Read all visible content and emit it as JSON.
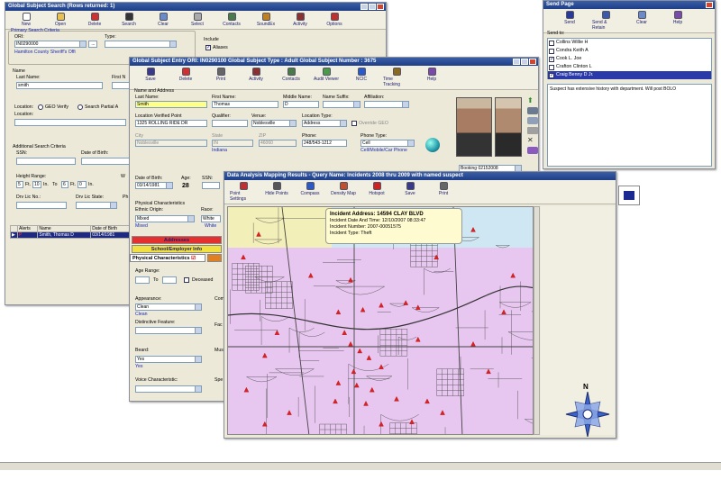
{
  "colors": {
    "titlebar": "#1e3e86",
    "map_bg": "#e7c6f0",
    "map_alt": "#cfe7f2",
    "map_yellow": "#f3efb8",
    "incident": "#e02020",
    "highlight": "#ffff88",
    "red_tab": "#e53030",
    "yellow_tab": "#f0e040"
  },
  "search": {
    "title": "Global Subject Search (Rows returned: 1)",
    "toolbar": [
      {
        "label": "New",
        "icon": "new-icon"
      },
      {
        "label": "Open",
        "icon": "folder-icon"
      },
      {
        "label": "Delete",
        "icon": "delete-icon"
      },
      {
        "label": "Search",
        "icon": "binoculars-icon"
      },
      {
        "label": "Clear",
        "icon": "clear-icon"
      },
      {
        "label": "Select",
        "icon": "select-icon"
      },
      {
        "label": "Contacts",
        "icon": "contacts-icon"
      },
      {
        "label": "SoundEx",
        "icon": "soundex-icon"
      },
      {
        "label": "Activity",
        "icon": "activity-icon"
      },
      {
        "label": "Options",
        "icon": "options-icon"
      }
    ],
    "primary_group": "Primary Search Criteria",
    "ori_label": "ORI:",
    "ori_value": "IN0290000",
    "ori_name": "Hamilton County Sheriff's Offi",
    "type_label": "Type:",
    "include_label": "Include",
    "aliases_label": "Aliases",
    "name_group": "Name",
    "last_name_label": "Last Name:",
    "last_name_value": "smith",
    "first_name_label": "First N",
    "location_label": "Location:",
    "geo_verify": "GEO Verify",
    "search_partial": "Search Partial A",
    "location_field_label": "Location:",
    "additional_group": "Additional Search Criteria",
    "ssn_label": "SSN:",
    "dob_label": "Date of Birth:",
    "height_label": "Height Range:",
    "h_from_ft": "5",
    "h_from_in": "10",
    "h_to_ft": "6",
    "h_to_in": "0",
    "ft": "Ft.",
    "in": "In.",
    "to": "To",
    "w_label": "W",
    "drv_lic_no": "Drv Lic No.:",
    "drv_lic_state": "Drv Lic State:",
    "ph_label": "Ph",
    "columns": [
      "Alerts",
      "Name",
      "Date of Birth"
    ],
    "rows": [
      {
        "alerts": "P",
        "name": "Smith, Thomas D",
        "dob": "03/14/1981"
      }
    ]
  },
  "entry": {
    "title": "Global Subject Entry   ORI: IN0290100   Global Subject Type : Adult   Global Subject Number : 3675",
    "toolbar": [
      {
        "label": "Save",
        "icon": "save-icon"
      },
      {
        "label": "Delete",
        "icon": "delete-icon"
      },
      {
        "label": "Print",
        "icon": "print-icon"
      },
      {
        "label": "Activity",
        "icon": "activity-icon"
      },
      {
        "label": "Contacts",
        "icon": "contacts-icon"
      },
      {
        "label": "Audit Viewer",
        "icon": "audit-icon"
      },
      {
        "label": "NCIC",
        "icon": "ncic-icon"
      },
      {
        "label": "Time Tracking",
        "icon": "clock-icon"
      },
      {
        "label": "Help",
        "icon": "help-icon"
      }
    ],
    "section": "Name and Address",
    "last_name_label": "Last Name:",
    "last_name": "Smith",
    "first_name_label": "First Name:",
    "first_name": "Thomas",
    "middle_label": "Middle Name:",
    "middle": "D",
    "suffix_label": "Name Suffix:",
    "affiliation_label": "Affiliation:",
    "location_label": "Location Verified Point",
    "location": "1325 ROLLING RIDE DR",
    "qualifier_label": "Qualifier:",
    "venue_label": "Venue:",
    "venue": "Noblesville",
    "loctype_label": "Location Type:",
    "loctype": "Address",
    "override_geo": "Override GEO",
    "city_label": "City",
    "city": "Noblesville",
    "state_label": "State",
    "state": "IN",
    "state_name": "Indiana",
    "zip_label": "ZIP",
    "zip": "46060",
    "phone_label": "Phone:",
    "phone": "248/543-1212",
    "phonetype_label": "Phone Type:",
    "phonetype": "Cell",
    "phonetype_desc": "Cell/Mobile/Car Phone",
    "booking": "Booking 02152008",
    "dob_label": "Date of Birth:",
    "dob": "03/14/1981",
    "age_label": "Age:",
    "age": "28",
    "ssn_label": "SSN:",
    "physical_label": "Physical Characteristics",
    "ethnic_label": "Ethnic Origin:",
    "ethnic": "Mixed",
    "ethnic_below": "Mixed",
    "race_label": "Race:",
    "race": "White",
    "race_below": "White",
    "tab_addresses": "Addresses",
    "tab_school": "School/Employer Info",
    "tab_physical": "Physical Characteristics",
    "age_range": "Age Range:",
    "to": "To",
    "deceased": "Deceased",
    "appearance_label": "Appearance:",
    "appearance": "Clean",
    "appearance_below": "Clean",
    "complex_label": "Com",
    "distinctive_label": "Distinctive Feature:",
    "face_label": "Fac",
    "beard_label": "Beard:",
    "beard": "Yes",
    "beard_below": "Yes",
    "mus_label": "Mus",
    "voice_label": "Voice Characteristic:",
    "spe_label": "Spe"
  },
  "send": {
    "title": "Send Page",
    "toolbar": [
      {
        "label": "Send",
        "icon": "send-icon"
      },
      {
        "label": "Send & Retain",
        "icon": "send-retain-icon"
      },
      {
        "label": "Clear",
        "icon": "clear-icon"
      },
      {
        "label": "Help",
        "icon": "help-icon"
      }
    ],
    "send_to_label": "Send to:",
    "recipients": [
      {
        "name": "Collins Willie H",
        "checked": false
      },
      {
        "name": "Condra Keith A",
        "checked": false
      },
      {
        "name": "Cook L. Joe",
        "checked": true
      },
      {
        "name": "Crafton Clinton L",
        "checked": false
      },
      {
        "name": "Craig Benny D Jr.",
        "checked": true
      }
    ],
    "message": "Suspect has extensive history with department.  Will post BOLO"
  },
  "map": {
    "title": "Data Analysis Mapping Results - Query Name: Incidents 2008 thru 2009 with named suspect",
    "toolbar": [
      {
        "label": "Point Settings",
        "icon": "point-settings-icon"
      },
      {
        "label": "Hide Points",
        "icon": "hide-points-icon"
      },
      {
        "label": "Compass",
        "icon": "compass-icon"
      },
      {
        "label": "Density Map",
        "icon": "density-icon"
      },
      {
        "label": "Hotspot",
        "icon": "hotspot-icon"
      },
      {
        "label": "Save",
        "icon": "save-icon"
      },
      {
        "label": "Print",
        "icon": "print-icon"
      }
    ],
    "tooltip_title": "Incident Address: 14594 CLAY BLVD",
    "tooltip_lines": [
      "Incident Date And Time: 12/10/2007 08:33:47",
      "Incident Number: 2007-00051575",
      "Incident Type: Theft"
    ],
    "compass_n": "N",
    "incidents": [
      [
        0.1,
        0.12
      ],
      [
        0.45,
        0.07
      ],
      [
        0.6,
        0.05
      ],
      [
        0.8,
        0.1
      ],
      [
        0.93,
        0.3
      ],
      [
        0.4,
        0.32
      ],
      [
        0.36,
        0.46
      ],
      [
        0.44,
        0.45
      ],
      [
        0.5,
        0.43
      ],
      [
        0.58,
        0.42
      ],
      [
        0.62,
        0.44
      ],
      [
        0.9,
        0.46
      ],
      [
        0.16,
        0.55
      ],
      [
        0.38,
        0.55
      ],
      [
        0.4,
        0.6
      ],
      [
        0.43,
        0.63
      ],
      [
        0.46,
        0.66
      ],
      [
        0.5,
        0.7
      ],
      [
        0.41,
        0.72
      ],
      [
        0.36,
        0.77
      ],
      [
        0.42,
        0.78
      ],
      [
        0.47,
        0.8
      ],
      [
        0.35,
        0.85
      ],
      [
        0.45,
        0.86
      ],
      [
        0.55,
        0.84
      ],
      [
        0.65,
        0.85
      ],
      [
        0.06,
        0.8
      ],
      [
        0.2,
        0.9
      ],
      [
        0.12,
        0.95
      ],
      [
        0.5,
        0.95
      ],
      [
        0.6,
        0.94
      ],
      [
        0.7,
        0.9
      ],
      [
        0.8,
        0.6
      ],
      [
        0.85,
        0.72
      ],
      [
        0.62,
        0.58
      ],
      [
        0.68,
        0.22
      ],
      [
        0.27,
        0.3
      ],
      [
        0.05,
        0.22
      ],
      [
        0.12,
        0.65
      ]
    ]
  }
}
